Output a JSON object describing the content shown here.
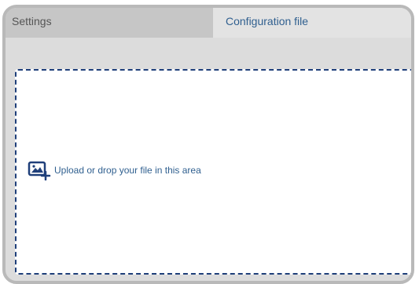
{
  "tabs": [
    {
      "label": "Settings",
      "active": false
    },
    {
      "label": "Configuration file",
      "active": true
    }
  ],
  "dropzone": {
    "icon": "add-image-icon",
    "text": "Upload or drop your file in this area"
  },
  "colors": {
    "panel_bg": "#dcdcdc",
    "panel_border": "#b9b9b9",
    "inactive_tab_bg": "#c6c6c6",
    "active_tab_text": "#2f5f8f",
    "dropzone_border": "#1f3f7a"
  }
}
